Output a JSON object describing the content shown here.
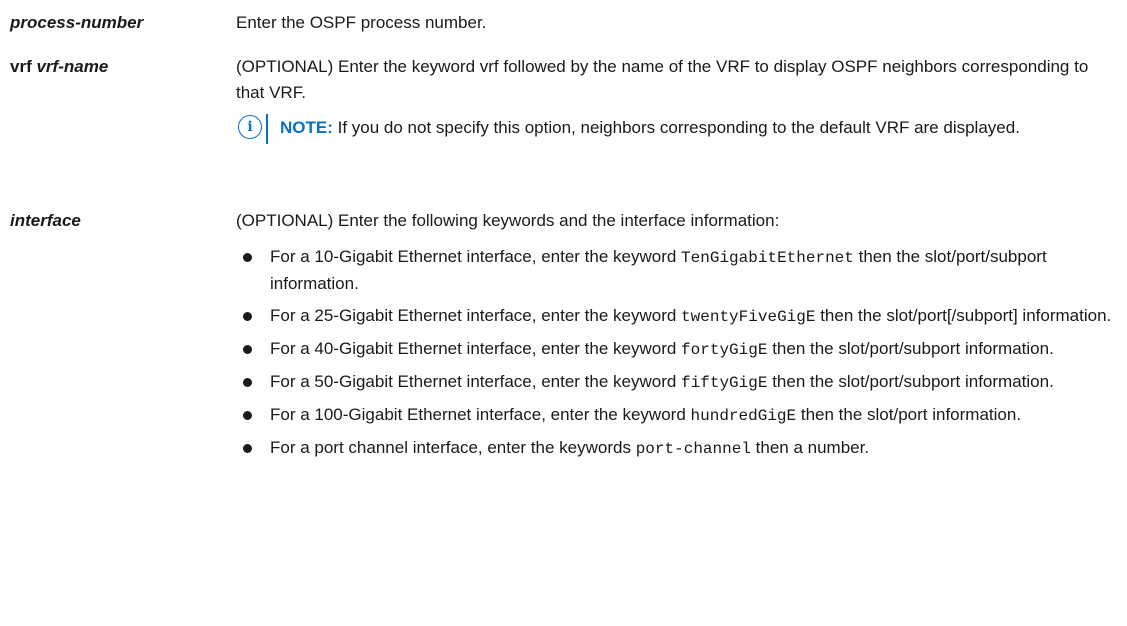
{
  "rows": [
    {
      "term": "process-number",
      "desc": "Enter the OSPF process number."
    },
    {
      "term_kw": "vrf",
      "term_arg": "vrf-name",
      "desc": "(OPTIONAL) Enter the keyword vrf followed by the name of the VRF to display OSPF neighbors corresponding to that VRF.",
      "note": {
        "label": "NOTE:",
        "text": "If you do not specify this option, neighbors corresponding to the default VRF are displayed."
      }
    },
    {
      "term": "interface",
      "desc": "(OPTIONAL) Enter the following keywords and the interface information:",
      "bullets": [
        {
          "pre": "For a 10-Gigabit Ethernet interface, enter the keyword ",
          "kw": "TenGigabitEthernet",
          "post": " then the slot/port/subport information."
        },
        {
          "pre": "For a 25-Gigabit Ethernet interface, enter the keyword ",
          "kw": "twentyFiveGigE",
          "post": " then the slot/port[/subport] information."
        },
        {
          "pre": "For a 40-Gigabit Ethernet interface, enter the keyword ",
          "kw": "fortyGigE",
          "post": " then the slot/port/subport information."
        },
        {
          "pre": "For a 50-Gigabit Ethernet interface, enter the keyword ",
          "kw": "fiftyGigE",
          "post": " then the slot/port/subport information."
        },
        {
          "pre": "For a 100-Gigabit Ethernet interface, enter the keyword ",
          "kw": "hundredGigE",
          "post": " then the slot/port information."
        },
        {
          "pre": "For a port channel interface, enter the keywords ",
          "kw": "port-channel",
          "post": " then a number."
        }
      ]
    }
  ],
  "colors": {
    "accent": "#0672cb",
    "text": "#1a1a1a"
  },
  "icons": {
    "note": "info-icon",
    "bullet": "bullet-dot"
  }
}
